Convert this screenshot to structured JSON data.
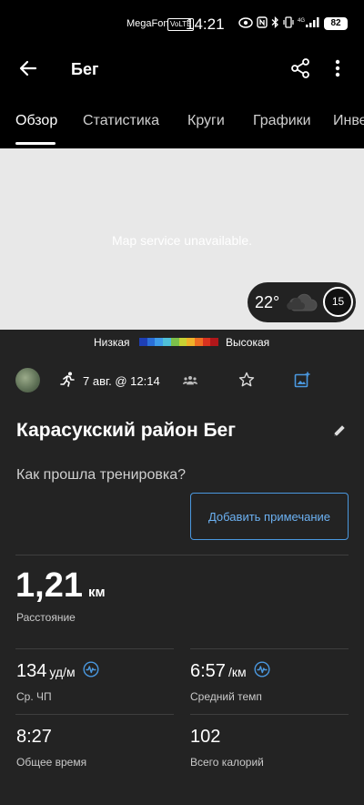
{
  "status_bar": {
    "carrier": "MegaFon",
    "network_badge": "VoLTE",
    "time": "14:21",
    "signal_label": "4G",
    "battery": "82"
  },
  "app_bar": {
    "title": "Бег",
    "back_icon": "back-arrow-icon",
    "share_icon": "share-icon",
    "more_icon": "more-vertical-icon"
  },
  "tabs": [
    {
      "label": "Обзор",
      "active": true
    },
    {
      "label": "Статистика",
      "active": false
    },
    {
      "label": "Круги",
      "active": false
    },
    {
      "label": "Графики",
      "active": false
    },
    {
      "label": "Инве",
      "active": false
    }
  ],
  "map": {
    "message": "Map service unavailable.",
    "weather": {
      "temperature": "22°",
      "wind": "15",
      "condition_icon": "cloud-icon"
    }
  },
  "legend": {
    "low": "Низкая",
    "high": "Высокая",
    "colors": [
      "#1e3fb5",
      "#2a6fd8",
      "#3e9ce9",
      "#4fc0d8",
      "#7cc04a",
      "#c8d233",
      "#f0b22a",
      "#ee6e22",
      "#d8321f",
      "#b0171a"
    ]
  },
  "meta": {
    "date": "7 авг. @ 12:14"
  },
  "activity": {
    "title": "Карасукский район Бег",
    "question": "Как прошла тренировка?",
    "add_note": "Добавить примечание"
  },
  "stats": {
    "distance": {
      "value": "1,21",
      "unit": "км",
      "label": "Расстояние"
    },
    "avg_hr": {
      "value": "134",
      "unit": "уд/м",
      "label": "Ср. ЧП"
    },
    "avg_pace": {
      "value": "6:57",
      "unit": "/км",
      "label": "Средний темп"
    },
    "total_time": {
      "value": "8:27",
      "label": "Общее время"
    },
    "calories": {
      "value": "102",
      "label": "Всего калорий"
    }
  },
  "colors": {
    "accent": "#4a98df",
    "background": "#232323",
    "header": "#000000"
  }
}
